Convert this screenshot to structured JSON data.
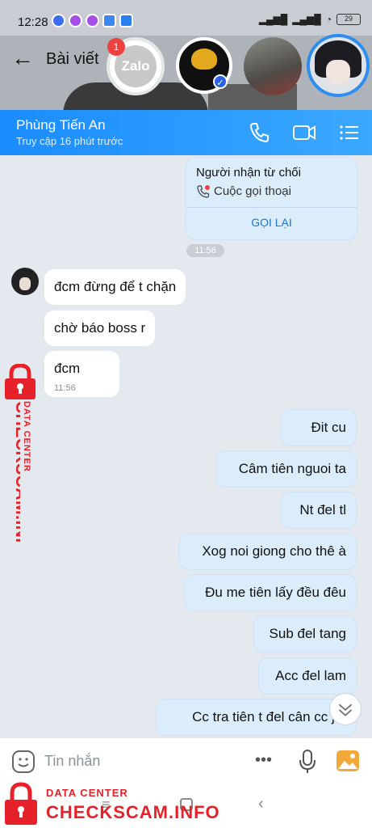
{
  "status_bar": {
    "time": "12:28",
    "battery": "29"
  },
  "background_page": {
    "title": "Bài viết"
  },
  "chat_heads": {
    "badge_count": "1",
    "zalo_label": "Zalo"
  },
  "chat_header": {
    "name": "Phùng Tiến An",
    "status": "Truy cập 16 phút trước"
  },
  "call_card": {
    "title": "Người nhận từ chối",
    "subtitle": "Cuộc gọi thoại",
    "action": "GỌI LẠI",
    "time": "11:56"
  },
  "incoming_messages": [
    {
      "text": "đcm đừng để t chặn"
    },
    {
      "text": "chờ báo boss r"
    },
    {
      "text": "đcm",
      "time": "11:56"
    }
  ],
  "outgoing_messages": [
    {
      "text": "Đit cu"
    },
    {
      "text": "Câm tiên nguoi ta"
    },
    {
      "text": "Nt đel tl"
    },
    {
      "text": "Xog noi giong cho thê à"
    },
    {
      "text": "Đu me tiên lấy đều đêu"
    },
    {
      "text": "Sub đel tang"
    },
    {
      "text": "Acc đel lam"
    },
    {
      "text": "Cc tra tiên t đel cân cc j h"
    }
  ],
  "input": {
    "placeholder": "Tin nhắn"
  },
  "watermark": {
    "line1": "DATA CENTER",
    "line2": "CHECKSCAM.INFO"
  },
  "colors": {
    "header_blue": "#1a8cff",
    "outgoing_bubble": "#dbecfb",
    "chat_bg": "#e4e9f0",
    "watermark_red": "#e62129"
  }
}
